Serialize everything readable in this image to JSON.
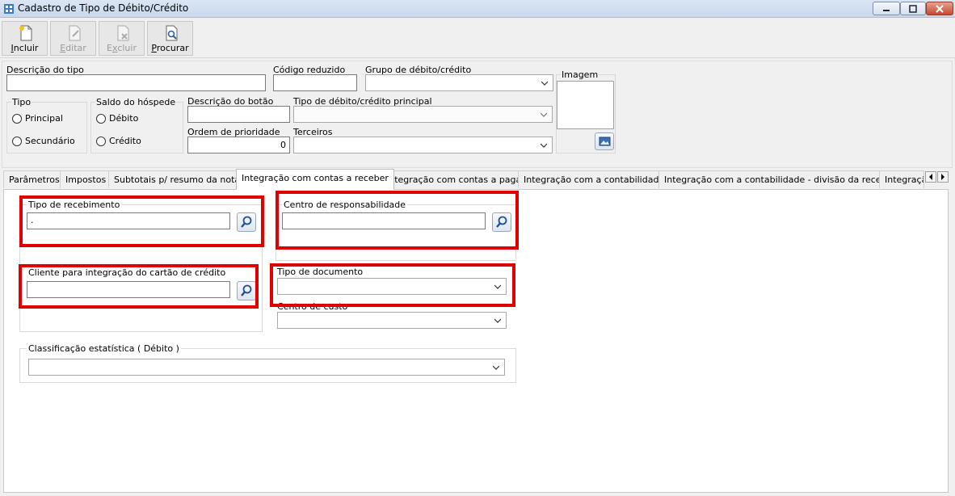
{
  "window": {
    "title": "Cadastro de Tipo de Débito/Crédito",
    "minimize_icon": "minimize-icon",
    "maximize_icon": "maximize-icon",
    "close_icon": "close-icon"
  },
  "toolbar": {
    "incluir_accel": "I",
    "incluir_rest": "ncluir",
    "editar_accel": "E",
    "editar_rest": "ditar",
    "excluir_pre": "E",
    "excluir_accel": "x",
    "excluir_rest": "cluir",
    "procurar_accel": "P",
    "procurar_rest": "rocurar"
  },
  "form": {
    "descricao_tipo_label": "Descrição do tipo",
    "descricao_tipo_value": "",
    "codigo_reduzido_label": "Código reduzido",
    "codigo_reduzido_value": "",
    "grupo_label": "Grupo de débito/crédito",
    "grupo_value": "",
    "imagem_label": "Imagem",
    "tipo_label": "Tipo",
    "tipo_options": [
      "Principal",
      "Secundário"
    ],
    "saldo_label": "Saldo do hóspede",
    "saldo_options": [
      "Débito",
      "Crédito"
    ],
    "descricao_botao_label": "Descrição do botão",
    "descricao_botao_value": "",
    "tipo_principal_label": "Tipo de débito/crédito principal",
    "tipo_principal_value": "",
    "ordem_label": "Ordem de prioridade",
    "ordem_value": "0",
    "terceiros_label": "Terceiros",
    "terceiros_value": ""
  },
  "tabs": [
    {
      "label": "Parâmetros",
      "active": false
    },
    {
      "label": "Impostos",
      "active": false
    },
    {
      "label": "Subtotais p/ resumo da nota",
      "active": false
    },
    {
      "label": "Integração com contas a receber",
      "active": true
    },
    {
      "label": "Integração com contas a pagar",
      "active": false
    },
    {
      "label": "Integração com a contabilidade",
      "active": false
    },
    {
      "label": "Integração com a contabilidade - divisão da receita",
      "active": false
    },
    {
      "label": "Integraçã",
      "active": false
    }
  ],
  "panel": {
    "tipo_recebimento_label": "Tipo de recebimento",
    "tipo_recebimento_value": ".",
    "centro_resp_label": "Centro de responsabilidade",
    "centro_resp_value": "",
    "cliente_label": "Cliente para integração do cartão de crédito",
    "cliente_value": "",
    "tipo_documento_label": "Tipo de documento",
    "tipo_documento_value": "",
    "centro_custo_label": "Centro de custo",
    "centro_custo_value": "",
    "classificacao_label": "Classificação estatística ( Débito )",
    "classificacao_value": ""
  },
  "icons": {
    "search": "search-icon",
    "dropdown": "chevron-down-icon",
    "image_picker": "image-icon",
    "scroll_left": "scroll-left-icon",
    "scroll_right": "scroll-right-icon"
  },
  "colors": {
    "highlight": "#e00000",
    "titlebar": "#c9d8ec"
  }
}
